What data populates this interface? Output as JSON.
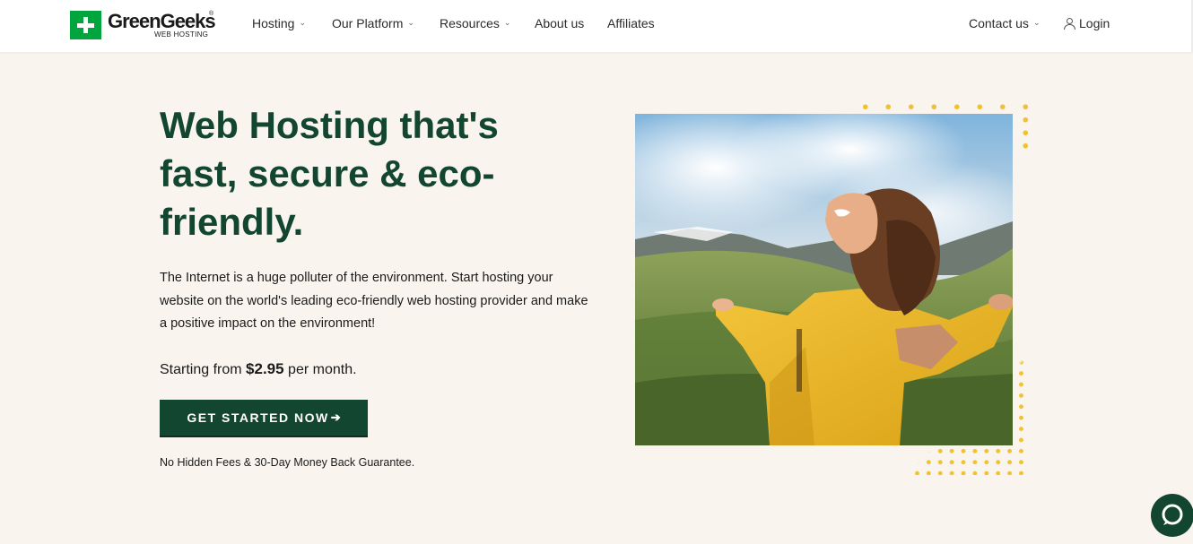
{
  "brand": {
    "name": "GreenGeeks",
    "registered_mark": "®",
    "subtitle": "WEB HOSTING",
    "primary_color": "#134631",
    "accent_green": "#00a63d",
    "accent_yellow": "#f2c12e",
    "background": "#f9f5ee"
  },
  "nav": {
    "items": [
      {
        "label": "Hosting",
        "has_dropdown": true
      },
      {
        "label": "Our Platform",
        "has_dropdown": true
      },
      {
        "label": "Resources",
        "has_dropdown": true
      },
      {
        "label": "About us",
        "has_dropdown": false
      },
      {
        "label": "Affiliates",
        "has_dropdown": false
      }
    ],
    "contact": {
      "label": "Contact us",
      "has_dropdown": true
    },
    "login": {
      "label": "Login",
      "icon": "user-icon"
    }
  },
  "hero": {
    "title": "Web Hosting that's fast, secure & eco-friendly.",
    "description": "The Internet is a huge polluter of the environment. Start hosting your website on the world's leading eco-friendly web hosting provider and make a positive impact on the environment!",
    "price_prefix": "Starting from",
    "price": "$2.95",
    "price_suffix": "per month.",
    "cta_label": "GET STARTED NOW",
    "cta_icon": "arrow-right-icon",
    "guarantee": "No Hidden Fees & 30-Day Money Back Guarantee."
  },
  "chat": {
    "icon": "chat-bubble-icon"
  }
}
